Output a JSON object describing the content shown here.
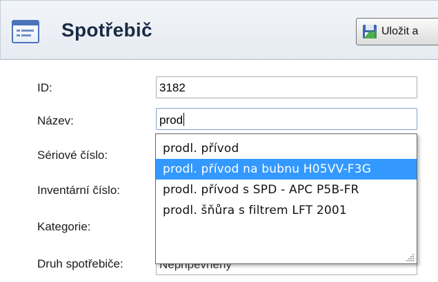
{
  "header": {
    "title": "Spotřebič",
    "form_icon": "form-icon",
    "save_label": "Uložit a",
    "save_icon": "save-disk-icon"
  },
  "form": {
    "id_label": "ID:",
    "id_value": "3182",
    "name_label": "Název:",
    "name_value": "prod",
    "serial_label": "Sériové číslo:",
    "inventory_label": "Inventární číslo:",
    "category_label": "Kategorie:",
    "type_label": "Druh spotřebiče:",
    "type_value": "Nepřipevněný"
  },
  "autocomplete": {
    "items": [
      "prodl. přívod",
      "prodl. přívod na bubnu H05VV-F3G",
      "prodl. přívod s SPD - APC P5B-FR",
      "prodl. šňůra s filtrem LFT 2001"
    ],
    "selected_index": 1,
    "colors": {
      "selection": "#3399ff"
    }
  }
}
